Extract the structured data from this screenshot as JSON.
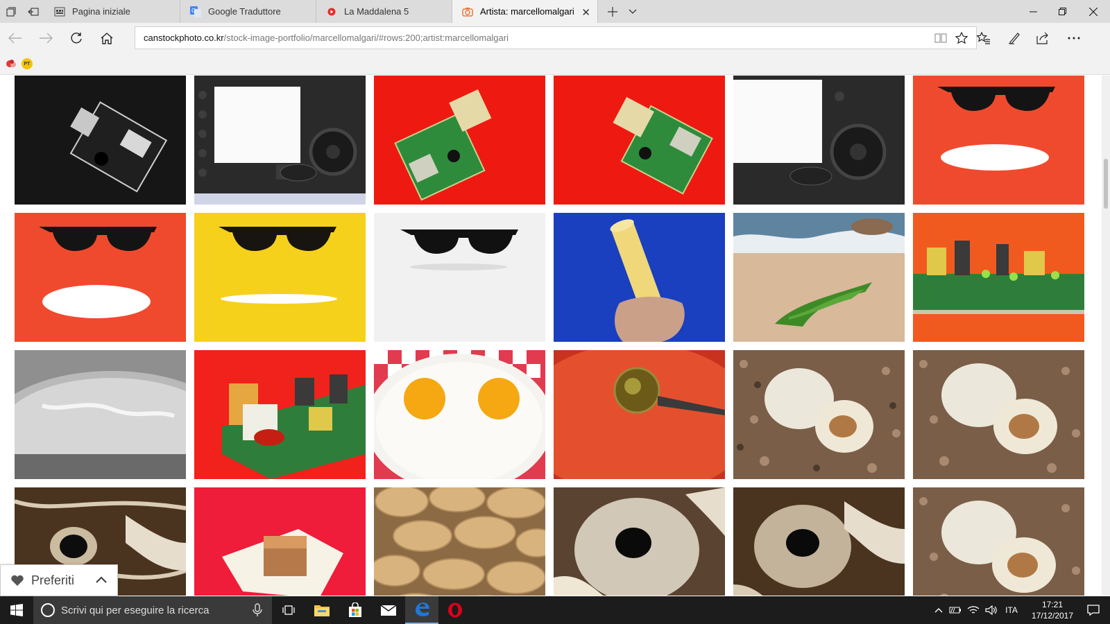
{
  "tabs": [
    {
      "label": "Pagina iniziale",
      "icon": "start-page-icon"
    },
    {
      "label": "Google Traduttore",
      "icon": "google-translate-icon"
    },
    {
      "label": "La Maddalena 5",
      "icon": "youtube-icon"
    },
    {
      "label": "Artista: marcellomalgari",
      "icon": "canstock-icon",
      "active": true
    }
  ],
  "address": {
    "host": "canstockphoto.co.kr",
    "path": "/stock-image-portfolio/marcellomalgari/#rows:200;artist:marcellomalgari"
  },
  "favorites_bar": {
    "items": [
      "red-bookmark-icon",
      "pt-bookmark-icon"
    ],
    "pt_label": "PT"
  },
  "gallery": {
    "rows": [
      [
        "usb-board-on-black",
        "camera-back-screen",
        "usb-board-on-red",
        "usb-board-on-red",
        "camera-back-screen-right",
        "sunglasses-on-red"
      ],
      [
        "sunglasses-on-red-ellipse",
        "sunglasses-on-yellow",
        "sunglasses-on-white",
        "spaghetti-on-blue",
        "seaweed-on-beach",
        "circuit-board-on-orange"
      ],
      [
        "boiling-water-pot",
        "circuit-board-red",
        "fried-eggs-checkered",
        "tomato-sauce-oil-spoon",
        "shells-on-pebbles",
        "shells-on-pebbles"
      ],
      [
        "spider-web-hole",
        "candy-on-red",
        "peanuts",
        "spider-web-hole",
        "spider-web-hole",
        "shells-on-pebbles"
      ]
    ]
  },
  "preferiti": {
    "label": "Preferiti"
  },
  "taskbar": {
    "search_placeholder": "Scrivi qui per eseguire la ricerca",
    "language": "ITA",
    "time": "17:21",
    "date": "17/12/2017"
  },
  "colors": {
    "tabstrip": "#dcdcdc",
    "toolbar": "#f2f2f2",
    "taskbar": "#1c1c1c",
    "edge_blue": "#1e78d6",
    "opera_red": "#e0001b"
  }
}
